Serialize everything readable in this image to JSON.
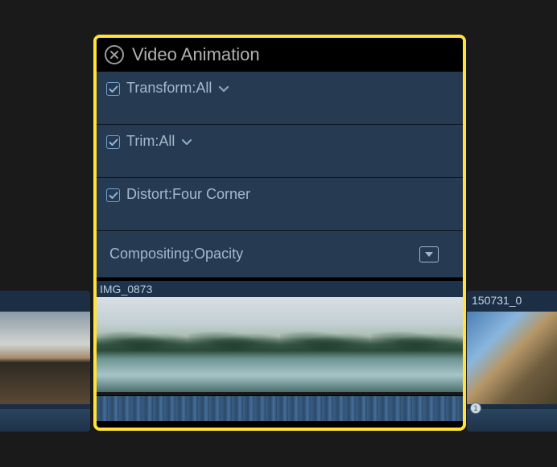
{
  "panel": {
    "title": "Video Animation",
    "rows": [
      {
        "label": "Transform:All",
        "checked": true,
        "has_dropdown": true
      },
      {
        "label": "Trim:All",
        "checked": true,
        "has_dropdown": true
      },
      {
        "label": "Distort:Four Corner",
        "checked": true,
        "has_dropdown": false
      }
    ],
    "compositing_label": "Compositing:Opacity"
  },
  "clip": {
    "main_label": "IMG_0873",
    "right_label": "150731_0"
  }
}
